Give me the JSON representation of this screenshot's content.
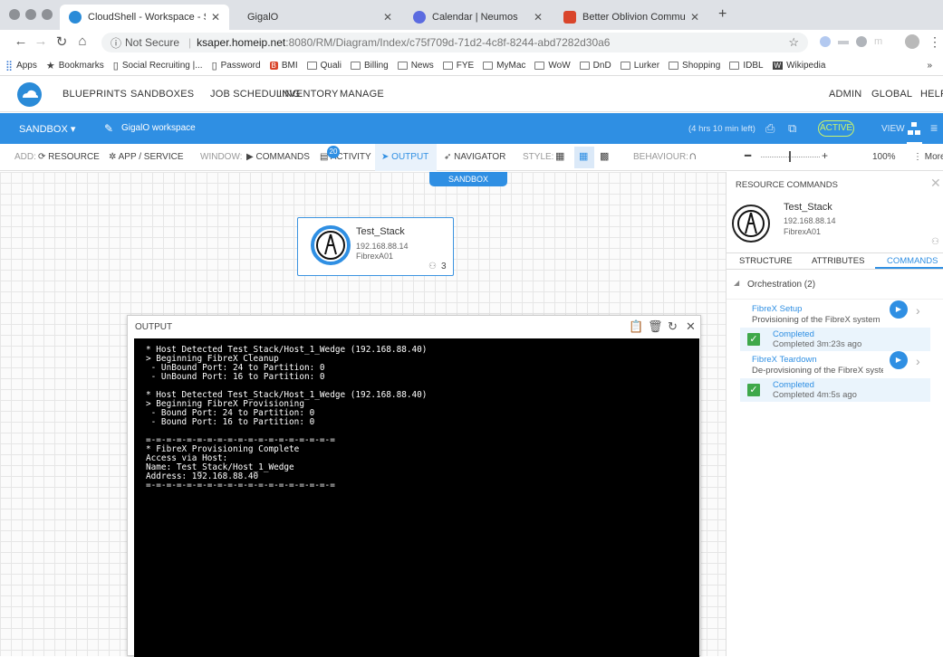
{
  "browser": {
    "tabs": [
      {
        "title": "CloudShell - Workspace - San",
        "favicon": "cloudshell-icon",
        "active": true
      },
      {
        "title": "GigalO",
        "favicon": "none",
        "active": false
      },
      {
        "title": "Calendar | Neumos",
        "favicon": "calendar-icon",
        "active": false
      },
      {
        "title": "Better Oblivion Community Ce",
        "favicon": "e-icon",
        "active": false
      }
    ],
    "new_tab": "+",
    "url": {
      "security": "Not Secure",
      "host": "ksaper.homeip.net",
      "path": ":8080/RM/Diagram/Index/c75f709d-71d2-4c8f-8244-abd7282d30a6"
    },
    "bookmarks": [
      {
        "label": "Apps",
        "icon": "apps-icon"
      },
      {
        "label": "Bookmarks",
        "icon": "star-icon"
      },
      {
        "label": "Social Recruiting |...",
        "icon": "page-icon"
      },
      {
        "label": "Password",
        "icon": "page-icon"
      },
      {
        "label": "BMI",
        "icon": "bmi-icon"
      },
      {
        "label": "Quali",
        "icon": "folder-icon"
      },
      {
        "label": "Billing",
        "icon": "folder-icon"
      },
      {
        "label": "News",
        "icon": "folder-icon"
      },
      {
        "label": "FYE",
        "icon": "folder-icon"
      },
      {
        "label": "MyMac",
        "icon": "folder-icon"
      },
      {
        "label": "WoW",
        "icon": "folder-icon"
      },
      {
        "label": "DnD",
        "icon": "folder-icon"
      },
      {
        "label": "Lurker",
        "icon": "folder-icon"
      },
      {
        "label": "Shopping",
        "icon": "folder-icon"
      },
      {
        "label": "IDBL",
        "icon": "folder-icon"
      },
      {
        "label": "Wikipedia",
        "icon": "wikipedia-icon"
      }
    ],
    "bookmarks_more": "»"
  },
  "app": {
    "nav": [
      "BLUEPRINTS",
      "SANDBOXES",
      "JOB SCHEDULING",
      "INVENTORY",
      "MANAGE"
    ],
    "right_nav": [
      "ADMIN",
      "GLOBAL",
      "HELP"
    ],
    "accent_color": "#2f8fe3"
  },
  "sandbox_bar": {
    "sandbox_label": "SANDBOX",
    "workspace_name": "GigalO workspace",
    "time_left": "(4 hrs 10 min left)",
    "status": "ACTIVE",
    "view_label": "VIEW"
  },
  "toolbar": {
    "add_label": "ADD:",
    "resource": "RESOURCE",
    "app_service": "APP / SERVICE",
    "window_label": "WINDOW:",
    "commands": "COMMANDS",
    "activity_badge": "20",
    "activity": "ACTIVITY",
    "output": "OUTPUT",
    "navigator": "NAVIGATOR",
    "style_label": "STYLE:",
    "behaviour_label": "BEHAVIOUR:",
    "zoom": "100%",
    "more": "More"
  },
  "canvas": {
    "sandbox_tab": "SANDBOX",
    "resource": {
      "name": "Test_Stack",
      "ip": "192.168.88.14",
      "model": "FibrexA01",
      "connections": "3"
    }
  },
  "output_panel": {
    "title": "OUTPUT",
    "lines": [
      "* Host Detected Test_Stack/Host_1_Wedge (192.168.88.40)",
      "> Beginning FibreX Cleanup",
      " - UnBound Port: 24 to Partition: 0",
      " - UnBound Port: 16 to Partition: 0",
      "",
      "* Host Detected Test_Stack/Host_1_Wedge (192.168.88.40)",
      "> Beginning FibreX Provisioning",
      " - Bound Port: 24 to Partition: 0",
      " - Bound Port: 16 to Partition: 0",
      "",
      "=-=-=-=-=-=-=-=-=-=-=-=-=-=-=-=-=-=-=",
      "* FibreX Provisioning Complete",
      "Access via Host:",
      "Name: Test_Stack/Host_1_Wedge",
      "Address: 192.168.88.40",
      "=-=-=-=-=-=-=-=-=-=-=-=-=-=-=-=-=-=-="
    ]
  },
  "resource_commands": {
    "title": "RESOURCE COMMANDS",
    "resource_name": "Test_Stack",
    "ip": "192.168.88.14",
    "model": "FibrexA01",
    "tabs": [
      "STRUCTURE",
      "ATTRIBUTES",
      "COMMANDS"
    ],
    "active_tab": "COMMANDS",
    "group": "Orchestration (2)",
    "commands": [
      {
        "name": "FibreX Setup",
        "description": "Provisioning of the FibreX system",
        "status": "Completed",
        "time": "Completed 3m:23s ago"
      },
      {
        "name": "FibreX Teardown",
        "description": "De-provisioning of the FibreX syste...",
        "status": "Completed",
        "time": "Completed 4m:5s ago"
      }
    ]
  }
}
